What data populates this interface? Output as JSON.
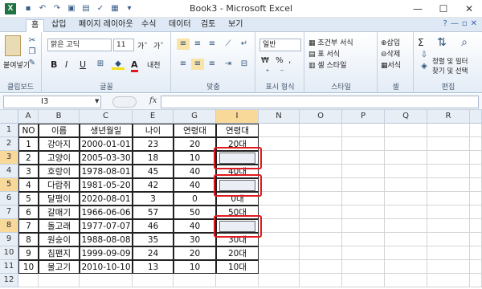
{
  "titlebar": {
    "title": "Book3 - Microsoft Excel",
    "minimize": "—",
    "maximize": "☐",
    "close": "✕"
  },
  "tabs": [
    "홈",
    "삽입",
    "페이지 레이아웃",
    "수식",
    "데이터",
    "검토",
    "보기"
  ],
  "ribbon": {
    "clipboard": {
      "paste": "붙여넣기",
      "label": "클립보드"
    },
    "font": {
      "name": "맑은 고딕",
      "size": "11",
      "bold": "B",
      "italic": "I",
      "underline": "U",
      "grow": "가ˆ",
      "shrink": "가ˇ",
      "color_a": "A",
      "phonetic": "내천",
      "label": "글꼴"
    },
    "alignment": {
      "label": "맞춤"
    },
    "number": {
      "format": "일반",
      "currency": "₩",
      "percent": "%",
      "comma": ",",
      "label": "표시 형식"
    },
    "styles": {
      "conditional": "조건부 서식",
      "table": "표 서식",
      "cell": "셀 스타일",
      "label": "스타일"
    },
    "cells": {
      "insert": "삽입",
      "delete": "삭제",
      "format": "서식",
      "label": "셀"
    },
    "editing": {
      "sigma": "Σ",
      "sort": "정렬 및 필터",
      "find": "찾기 및 선택",
      "label": "편집"
    }
  },
  "formula_bar": {
    "name_box": "I3",
    "fx": "fx",
    "formula": ""
  },
  "sheet": {
    "columns": [
      "A",
      "B",
      "C",
      "E",
      "G",
      "I",
      "N",
      "O",
      "P",
      "Q",
      "R"
    ],
    "selected_column": "I",
    "row_numbers": [
      "1",
      "2",
      "3",
      "4",
      "5",
      "6",
      "7",
      "8",
      "9",
      "10",
      "11",
      "12"
    ],
    "selected_rows": [
      "3",
      "5",
      "8"
    ],
    "header": [
      "NO",
      "이름",
      "생년월일",
      "나이",
      "연령대",
      "연령대"
    ],
    "rows": [
      [
        "1",
        "강아지",
        "2000-01-01",
        "23",
        "20",
        "20대"
      ],
      [
        "2",
        "고양이",
        "2005-03-30",
        "18",
        "10",
        ""
      ],
      [
        "3",
        "호랑이",
        "1978-08-01",
        "45",
        "40",
        "40대"
      ],
      [
        "4",
        "다람쥐",
        "1981-05-20",
        "42",
        "40",
        ""
      ],
      [
        "5",
        "달팽이",
        "2020-08-01",
        "3",
        "0",
        "0대"
      ],
      [
        "6",
        "갈매기",
        "1966-06-06",
        "57",
        "50",
        "50대"
      ],
      [
        "7",
        "돌고래",
        "1977-07-07",
        "46",
        "40",
        ""
      ],
      [
        "8",
        "원숭이",
        "1988-08-08",
        "35",
        "30",
        "30대"
      ],
      [
        "9",
        "침팬지",
        "1999-09-09",
        "24",
        "20",
        "20대"
      ],
      [
        "10",
        "물고기",
        "2010-10-10",
        "13",
        "10",
        "10대"
      ]
    ]
  },
  "colors": {
    "excel_green": "#1f7244",
    "selection_header": "#f9d99a",
    "highlight_frame": "#e0191e"
  }
}
